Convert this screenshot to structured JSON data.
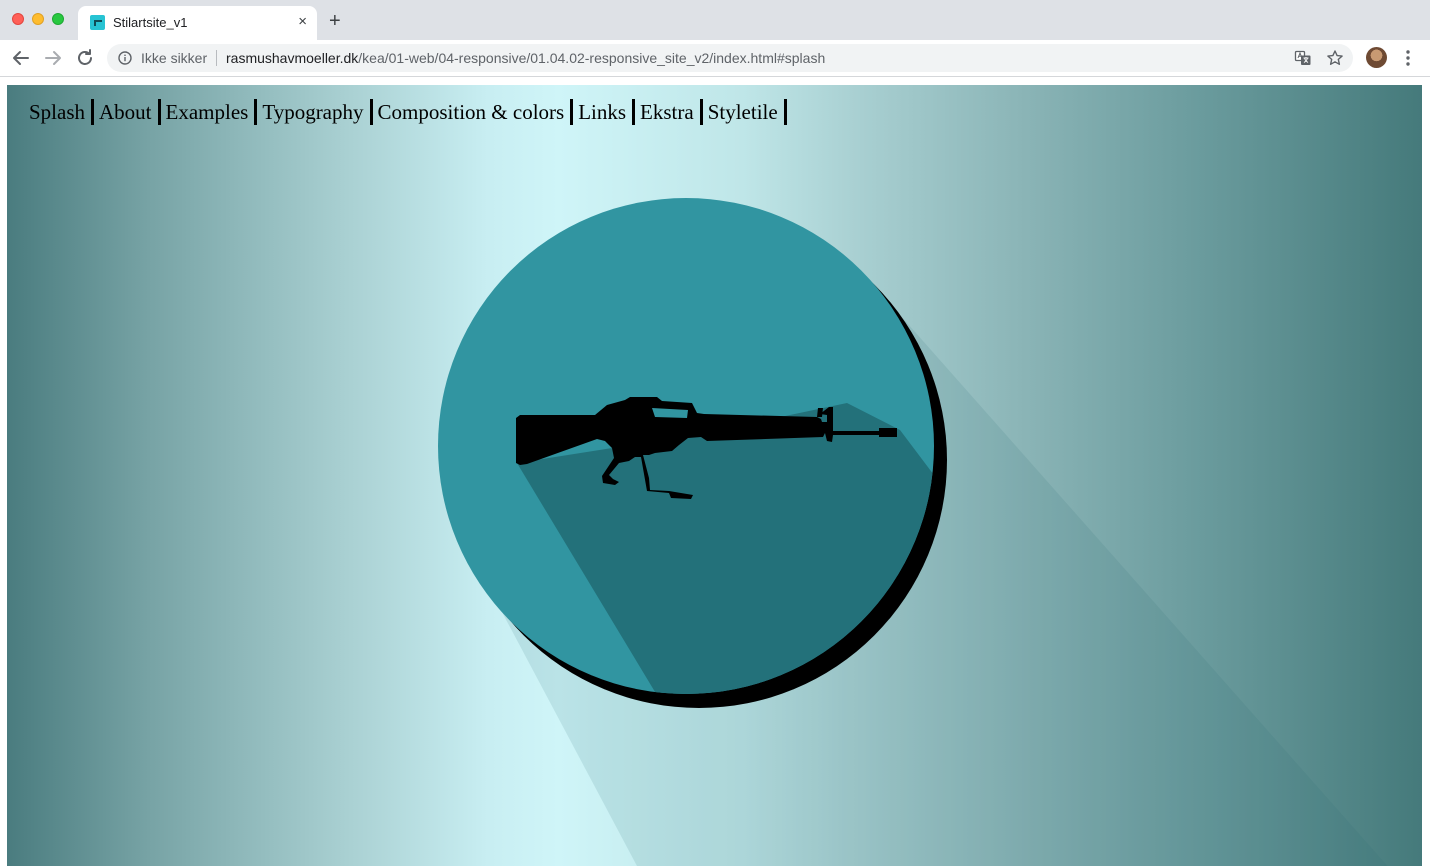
{
  "browser": {
    "tab_title": "Stilartsite_v1",
    "tab_close": "×",
    "new_tab": "+",
    "security_label": "Ikke sikker",
    "url_host": "rasmushavmoeller.dk",
    "url_path": "/kea/01-web/04-responsive/01.04.02-responsive_site_v2/index.html#splash",
    "icons": [
      "back-arrow-icon",
      "forward-arrow-icon",
      "reload-icon",
      "info-icon",
      "translate-icon",
      "star-icon",
      "avatar",
      "kebab-menu-icon"
    ]
  },
  "page": {
    "nav": [
      {
        "label": "Splash"
      },
      {
        "label": "About"
      },
      {
        "label": "Examples"
      },
      {
        "label": "Typography"
      },
      {
        "label": "Composition & colors"
      },
      {
        "label": "Links"
      },
      {
        "label": "Ekstra"
      },
      {
        "label": "Styletile"
      }
    ],
    "hero": {
      "icon": "rifle-silhouette-icon",
      "colors": {
        "circle": "#3195a1",
        "long_shadow": "#23717a",
        "drop_shadow": "#000000",
        "background_center": "#cff5f8",
        "background_edge": "#457a7b"
      }
    }
  }
}
